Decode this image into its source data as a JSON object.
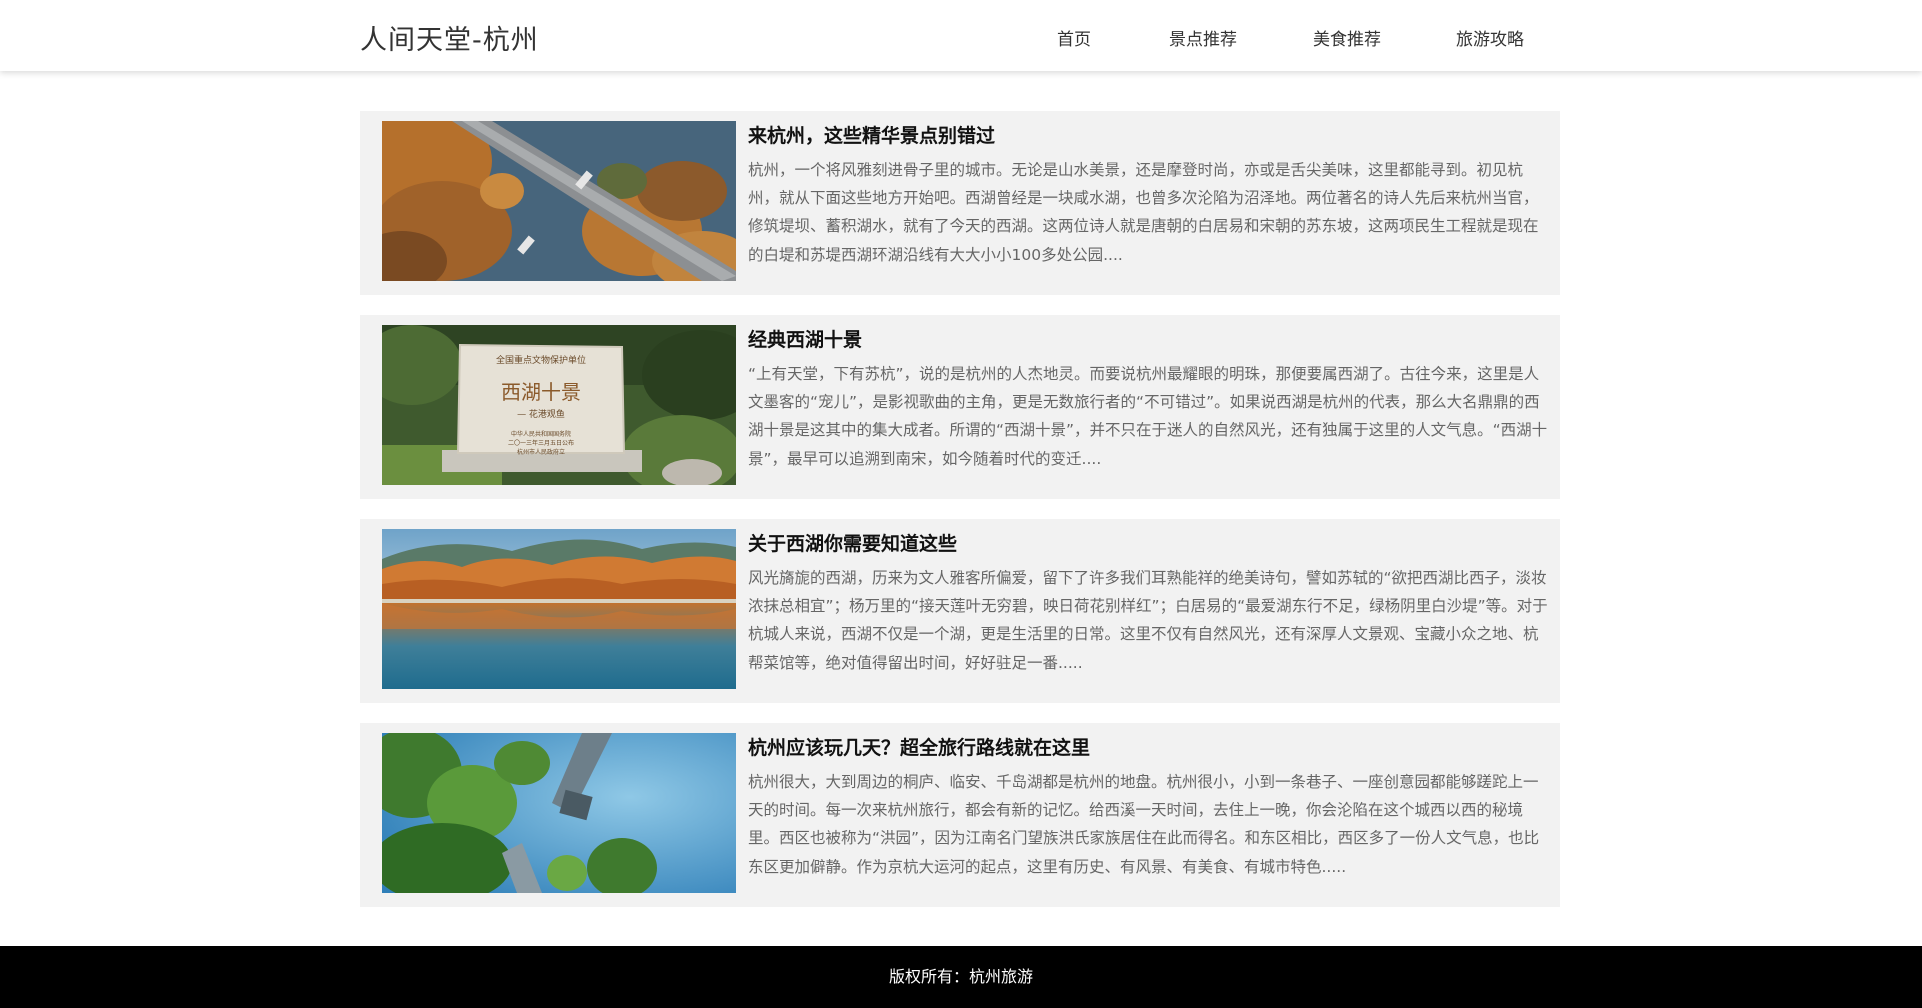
{
  "header": {
    "site_title": "人间天堂-杭州",
    "nav": [
      "首页",
      "景点推荐",
      "美食推荐",
      "旅游攻略"
    ]
  },
  "articles": [
    {
      "title": "来杭州，这些精华景点别错过",
      "summary": "杭州，一个将风雅刻进骨子里的城市。无论是山水美景，还是摩登时尚，亦或是舌尖美味，这里都能寻到。初见杭州，就从下面这些地方开始吧。西湖曾经是一块咸水湖，也曾多次沦陷为沼泽地。两位著名的诗人先后来杭州当官，修筑堤坝、蓄积湖水，就有了今天的西湖。这两位诗人就是唐朝的白居易和宋朝的苏东坡，这两项民生工程就是现在的白堤和苏堤西湖环湖沿线有大大小小100多处公园....",
      "image": "aerial-causeway-autumn-trees"
    },
    {
      "title": "经典西湖十景",
      "summary": "“上有天堂，下有苏杭”，说的是杭州的人杰地灵。而要说杭州最耀眼的明珠，那便要属西湖了。古往今来，这里是人文墨客的“宠儿”，是影视歌曲的主角，更是无数旅行者的“不可错过”。如果说西湖是杭州的代表，那么大名鼎鼎的西湖十景是这其中的集大成者。所谓的“西湖十景”，并不只在于迷人的自然风光，还有独属于这里的人文气息。“西湖十景”，最早可以追溯到南宋，如今随着时代的变迁....",
      "image": "stone-stele-xihu-shijing",
      "stele": {
        "top": "全国重点文物保护单位",
        "main": "西湖十景",
        "sub": "— 花港观鱼",
        "footer": [
          "中华人民共和国国务院",
          "二〇一三年三月五日公布",
          "杭州市人民政府立"
        ]
      }
    },
    {
      "title": "关于西湖你需要知道这些",
      "summary": "风光旖旎的西湖，历来为文人雅客所偏爱，留下了许多我们耳熟能祥的绝美诗句，譬如苏轼的“欲把西湖比西子，淡妆浓抹总相宜”；杨万里的“接天莲叶无穷碧，映日荷花别样红”；白居易的“最爱湖东行不足，绿杨阴里白沙堤”等。对于杭城人来说，西湖不仅是一个湖，更是生活里的日常。这里不仅有自然风光，还有深厚人文景观、宝藏小众之地、杭帮菜馆等，绝对值得留出时间，好好驻足一番.....",
      "image": "lake-reflection-autumn-shore"
    },
    {
      "title": "杭州应该玩几天？超全旅行路线就在这里",
      "summary": "杭州很大，大到周边的桐庐、临安、千岛湖都是杭州的地盘。杭州很小，小到一条巷子、一座创意园都能够蹉跎上一天的时间。每一次来杭州旅行，都会有新的记忆。给西溪一天时间，去住上一晚，你会沦陷在这个城西以西的秘境里。西区也被称为“洪园”，因为江南名门望族洪氏家族居住在此而得名。和东区相比，西区多了一份人文气息，也比东区更加僻静。作为京杭大运河的起点，这里有历史、有风景、有美食、有城市特色.....",
      "image": "aerial-island-pavilion-blue-water"
    }
  ],
  "footer": {
    "copyright": "版权所有：杭州旅游"
  },
  "colors": {
    "header_bg": "#ffffff",
    "card_bg": "#f2f2f2",
    "footer_bg": "#000000",
    "text_muted": "#666666"
  }
}
